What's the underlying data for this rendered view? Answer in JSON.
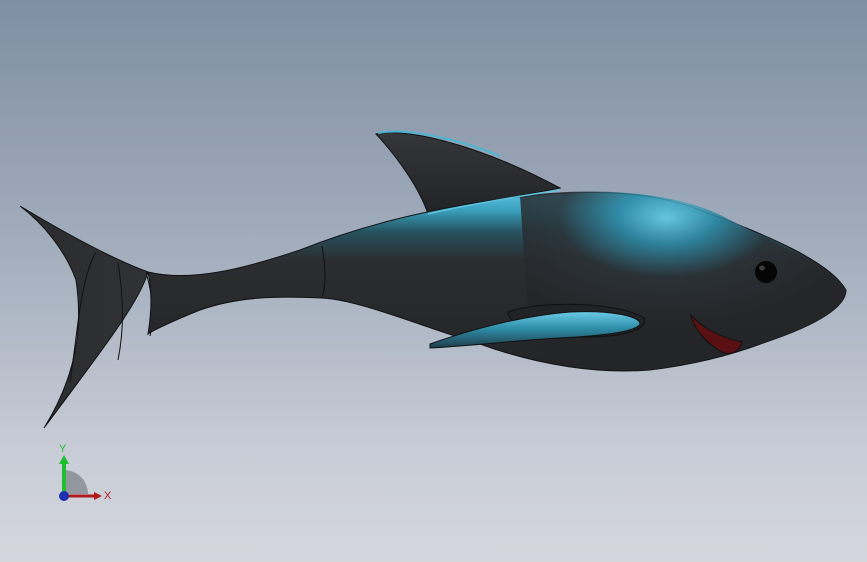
{
  "viewport": {
    "background_top": "#7f8ea3",
    "background_bottom": "#d4d7de"
  },
  "model": {
    "body_color": "#2b2d30",
    "highlight_color": "#3fa9c8",
    "eye_color": "#050505",
    "mouth_color": "#5a0f12"
  },
  "triad": {
    "y_label": "Y",
    "x_label": "X",
    "y_color": "#1fbf2f",
    "x_color": "#b01c1c",
    "z_color": "#1c2fb0"
  }
}
